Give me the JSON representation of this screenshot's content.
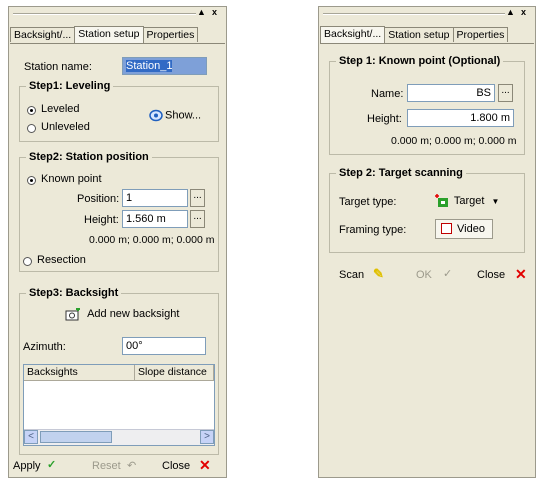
{
  "window_controls": {
    "pin": "▲",
    "close": "x"
  },
  "left": {
    "tabs": [
      "Backsight/...",
      "Station setup",
      "Properties"
    ],
    "station_name_label": "Station name:",
    "station_name_value": "Station_1",
    "step1": {
      "title": "Step1: Leveling",
      "opt_leveled": "Leveled",
      "opt_unleveled": "Unleveled",
      "show_label": "Show..."
    },
    "step2": {
      "title": "Step2: Station position",
      "opt_known": "Known point",
      "position_label": "Position:",
      "position_value": "1",
      "height_label": "Height:",
      "height_value": "1.560 m",
      "coords": "0.000 m; 0.000 m; 0.000 m",
      "opt_resection": "Resection",
      "browse": "..."
    },
    "step3": {
      "title": "Step3: Backsight",
      "add_label": "Add new backsight",
      "azimuth_label": "Azimuth:",
      "azimuth_value": "00°",
      "columns": [
        "Backsights",
        "Slope distance"
      ]
    },
    "footer": {
      "apply": "Apply",
      "reset": "Reset",
      "close": "Close"
    }
  },
  "right": {
    "tabs": [
      "Backsight/...",
      "Station setup",
      "Properties"
    ],
    "step1": {
      "title": "Step 1: Known point (Optional)",
      "name_label": "Name:",
      "name_value": "BS",
      "height_label": "Height:",
      "height_value": "1.800 m",
      "coords": "0.000 m; 0.000 m; 0.000 m",
      "browse": "..."
    },
    "step2": {
      "title": "Step 2: Target scanning",
      "target_type_label": "Target type:",
      "target_type_value": "Target",
      "framing_label": "Framing type:",
      "framing_value": "Video"
    },
    "footer": {
      "scan": "Scan",
      "ok": "OK",
      "close": "Close"
    }
  }
}
